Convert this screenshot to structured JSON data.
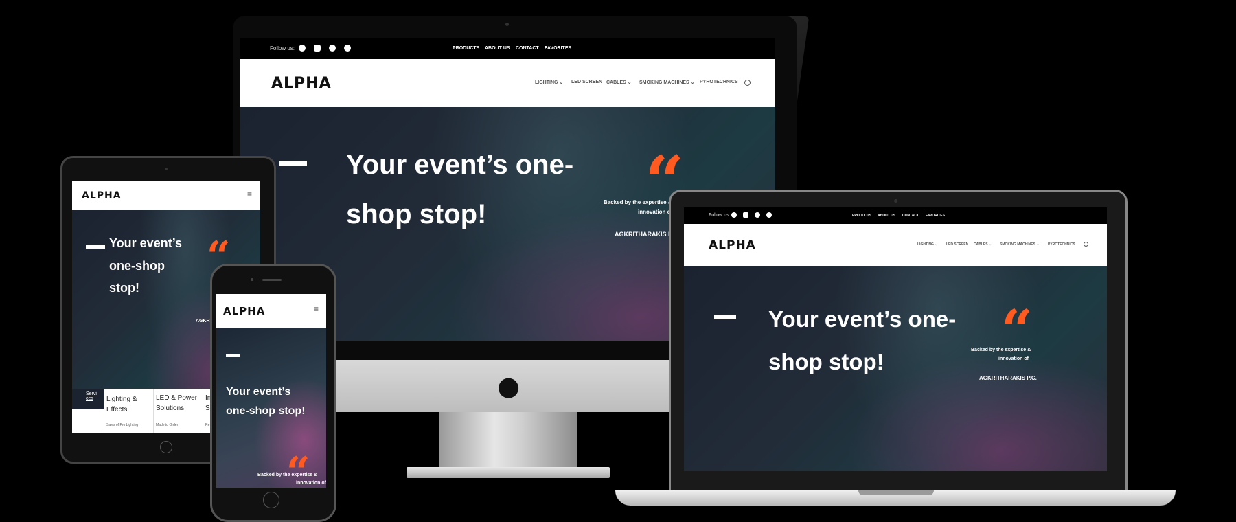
{
  "site": {
    "logo": "ALPHA",
    "follow_label": "Follow us:",
    "social_icons": [
      "facebook-icon",
      "instagram-icon",
      "pinterest-icon",
      "whatsapp-icon"
    ],
    "top_nav": [
      "PRODUCTS",
      "ABOUT US",
      "CONTACT",
      "FAVORITES"
    ],
    "main_nav": [
      "LIGHTING",
      "LED SCREEN",
      "CABLES",
      "SMOKING MACHINES",
      "PYROTECHNICS"
    ],
    "main_nav_dropdown": [
      "⌄",
      "",
      "⌄",
      "⌄",
      ""
    ],
    "headline_desktop_line1": "Your event’s one-",
    "headline_desktop_line2": "shop stop!",
    "tablet_headline_line1": "Your event’s",
    "tablet_headline_line2": "one-shop",
    "tablet_headline_line3": "stop!",
    "phone_headline_line1": "Your event’s",
    "phone_headline_line2": "one-shop stop!",
    "quote_mark": "“",
    "backed_line1": "Backed by the expertise &",
    "backed_line2": "innovation of",
    "backed_company": "AGKRITHARAKIS P.C.",
    "tablet_backed_company": "AGKRITH",
    "tablet_services_label": "Servi ces",
    "tablet_cards": [
      {
        "title": "Lighting & Effects",
        "sub": "Sales of Pro Lighting"
      },
      {
        "title": "LED & Power Solutions",
        "sub": "Made to Order"
      },
      {
        "title": "In Su",
        "sub": "Re"
      }
    ],
    "accent_color": "#ff5a1f"
  }
}
